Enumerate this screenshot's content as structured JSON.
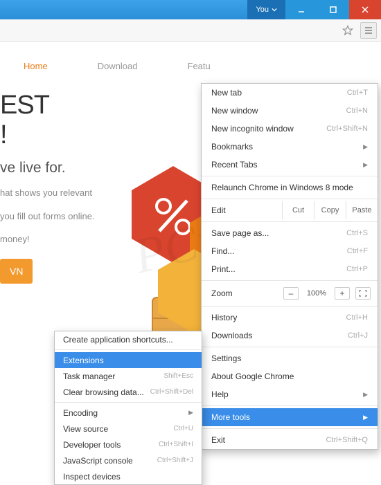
{
  "titlebar": {
    "user": "You"
  },
  "nav": {
    "home": "Home",
    "download": "Download",
    "features": "Featu"
  },
  "hero": {
    "title1": "EST",
    "title2": "!",
    "sub": "ve live for.",
    "desc1": "hat shows you relevant",
    "desc2": "you fill out forms online.",
    "desc3": "money!",
    "cta": "VN"
  },
  "main_menu": {
    "new_tab": "New tab",
    "new_tab_sc": "Ctrl+T",
    "new_window": "New window",
    "new_window_sc": "Ctrl+N",
    "incognito": "New incognito window",
    "incognito_sc": "Ctrl+Shift+N",
    "bookmarks": "Bookmarks",
    "recent": "Recent Tabs",
    "relaunch": "Relaunch Chrome in Windows 8 mode",
    "edit": "Edit",
    "cut": "Cut",
    "copy": "Copy",
    "paste": "Paste",
    "save": "Save page as...",
    "save_sc": "Ctrl+S",
    "find": "Find...",
    "find_sc": "Ctrl+F",
    "print": "Print...",
    "print_sc": "Ctrl+P",
    "zoom": "Zoom",
    "zoom_val": "100%",
    "history": "History",
    "history_sc": "Ctrl+H",
    "downloads": "Downloads",
    "downloads_sc": "Ctrl+J",
    "settings": "Settings",
    "about": "About Google Chrome",
    "help": "Help",
    "more_tools": "More tools",
    "exit": "Exit",
    "exit_sc": "Ctrl+Shift+Q"
  },
  "sub_menu": {
    "create": "Create application shortcuts...",
    "extensions": "Extensions",
    "task": "Task manager",
    "task_sc": "Shift+Esc",
    "clear": "Clear browsing data...",
    "clear_sc": "Ctrl+Shift+Del",
    "encoding": "Encoding",
    "view_source": "View source",
    "view_source_sc": "Ctrl+U",
    "dev": "Developer tools",
    "dev_sc": "Ctrl+Shift+I",
    "js": "JavaScript console",
    "js_sc": "Ctrl+Shift+J",
    "inspect": "Inspect devices"
  }
}
